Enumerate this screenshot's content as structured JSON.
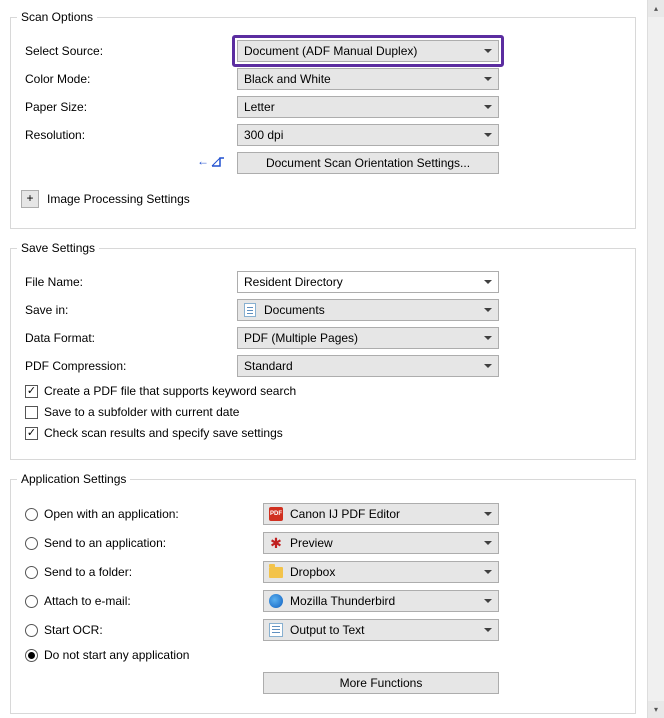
{
  "scan_options": {
    "legend": "Scan Options",
    "select_source": {
      "label": "Select Source:",
      "value": "Document (ADF Manual Duplex)"
    },
    "color_mode": {
      "label": "Color Mode:",
      "value": "Black and White"
    },
    "paper_size": {
      "label": "Paper Size:",
      "value": "Letter"
    },
    "resolution": {
      "label": "Resolution:",
      "value": "300 dpi"
    },
    "orientation_btn": "Document Scan Orientation Settings...",
    "image_processing": "Image Processing Settings"
  },
  "save_settings": {
    "legend": "Save Settings",
    "file_name": {
      "label": "File Name:",
      "value": "Resident Directory"
    },
    "save_in": {
      "label": "Save in:",
      "value": "Documents"
    },
    "data_format": {
      "label": "Data Format:",
      "value": "PDF (Multiple Pages)"
    },
    "pdf_compression": {
      "label": "PDF Compression:",
      "value": "Standard"
    },
    "cb_keyword": {
      "label": "Create a PDF file that supports keyword search",
      "checked": true
    },
    "cb_subfolder": {
      "label": "Save to a subfolder with current date",
      "checked": false
    },
    "cb_check_results": {
      "label": "Check scan results and specify save settings",
      "checked": true
    }
  },
  "app_settings": {
    "legend": "Application Settings",
    "options": [
      {
        "key": "open_app",
        "label": "Open with an application:",
        "value": "Canon IJ PDF Editor",
        "icon": "pdf"
      },
      {
        "key": "send_app",
        "label": "Send to an application:",
        "value": "Preview",
        "icon": "preview"
      },
      {
        "key": "send_folder",
        "label": "Send to a folder:",
        "value": "Dropbox",
        "icon": "folder"
      },
      {
        "key": "attach_mail",
        "label": "Attach to e-mail:",
        "value": "Mozilla Thunderbird",
        "icon": "thunderbird"
      },
      {
        "key": "start_ocr",
        "label": "Start OCR:",
        "value": "Output to Text",
        "icon": "text"
      }
    ],
    "do_not_start": "Do not start any application",
    "selected": "do_not_start",
    "more_functions": "More Functions"
  }
}
